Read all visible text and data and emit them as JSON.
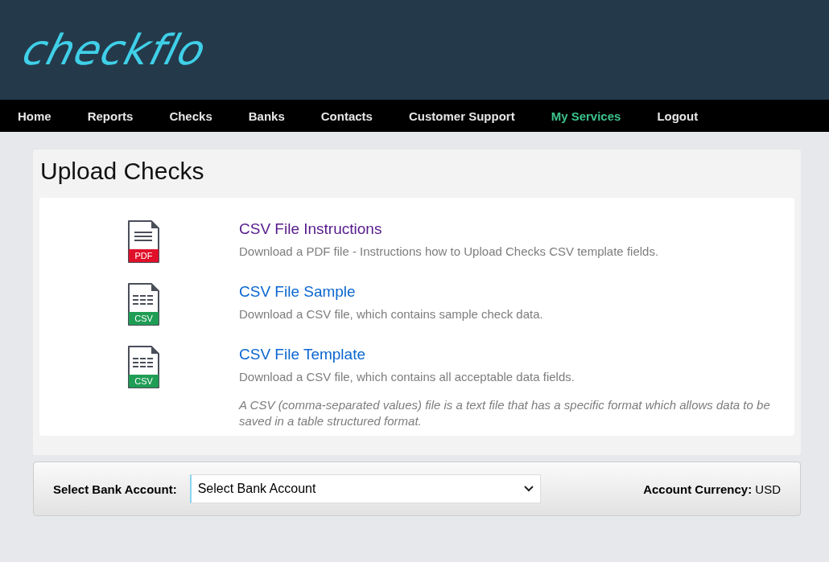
{
  "logo": "checkflo",
  "nav": [
    {
      "label": "Home",
      "selected": false
    },
    {
      "label": "Reports",
      "selected": false
    },
    {
      "label": "Checks",
      "selected": false
    },
    {
      "label": "Banks",
      "selected": false
    },
    {
      "label": "Contacts",
      "selected": false
    },
    {
      "label": "Customer Support",
      "selected": false
    },
    {
      "label": "My Services",
      "selected": true
    },
    {
      "label": "Logout",
      "selected": false
    }
  ],
  "page_title": "Upload Checks",
  "downloads": [
    {
      "kind": "pdf",
      "badge": "PDF",
      "title": "CSV File Instructions",
      "visited": true,
      "description": "Download a PDF file - Instructions how to Upload Checks CSV template fields."
    },
    {
      "kind": "csv",
      "badge": "CSV",
      "title": "CSV File Sample",
      "visited": false,
      "description": "Download a CSV file, which contains sample check data."
    },
    {
      "kind": "csv",
      "badge": "CSV",
      "title": "CSV File Template",
      "visited": false,
      "description": "Download a CSV file, which contains all acceptable data fields."
    }
  ],
  "note": "A CSV (comma-separated values) file is a text file that has a specific format which allows data to be saved in a table structured format.",
  "bank_select": {
    "label": "Select Bank Account:",
    "value": "Select Bank Account"
  },
  "currency": {
    "label": "Account Currency:",
    "value": "USD"
  }
}
